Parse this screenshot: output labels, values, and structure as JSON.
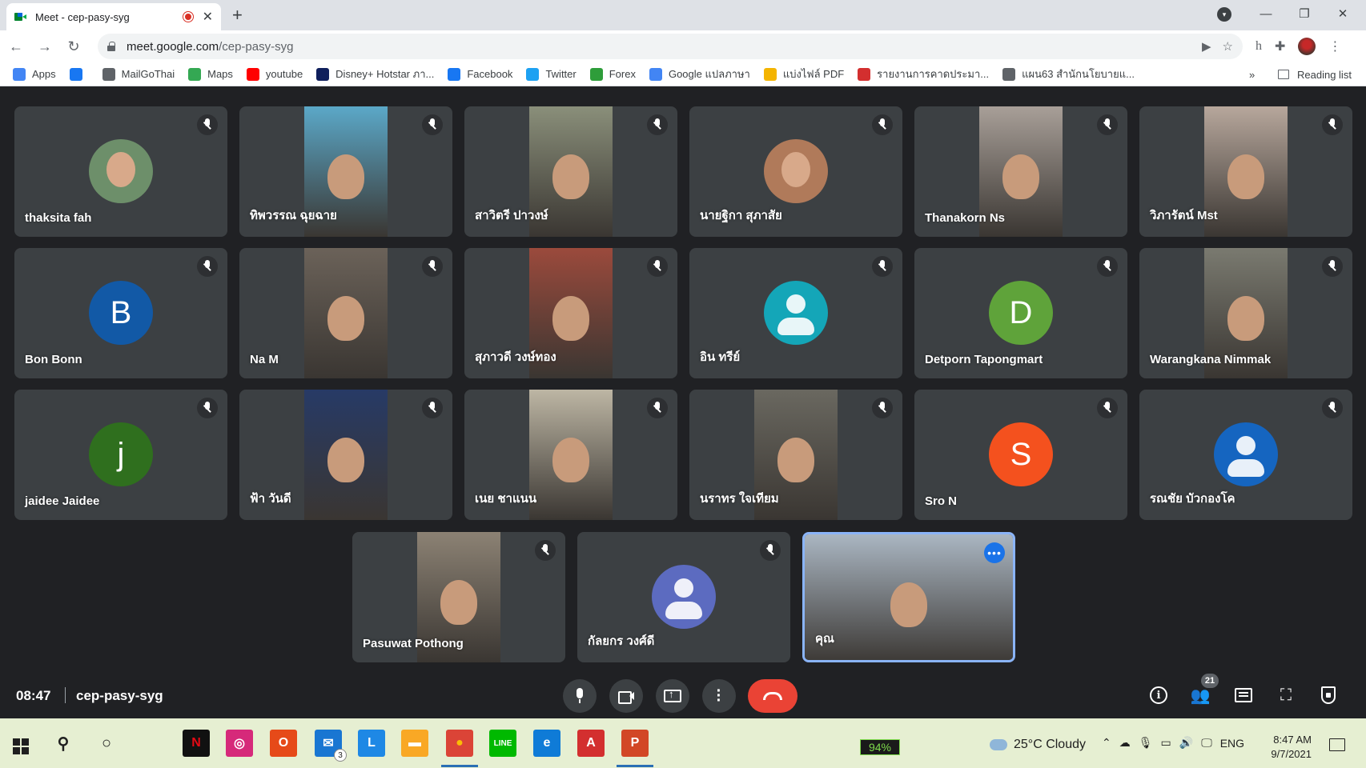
{
  "browser": {
    "tab_title": "Meet - cep-pasy-syg",
    "tab_close": "✕",
    "new_tab": "+",
    "url_host": "meet.google.com",
    "url_path": "/cep-pasy-syg",
    "window_controls": {
      "minimize": "—",
      "maximize": "❐",
      "close": "✕"
    },
    "bookmarks": [
      {
        "label": "Apps",
        "icon": "apps-grid-icon",
        "color": "#4285f4"
      },
      {
        "label": "",
        "icon": "facebook-icon",
        "color": "#1877f2"
      },
      {
        "label": "MailGoThai",
        "icon": "globe-icon",
        "color": "#5f6368"
      },
      {
        "label": "Maps",
        "icon": "maps-pin-icon",
        "color": "#34a853"
      },
      {
        "label": "youtube",
        "icon": "youtube-icon",
        "color": "#ff0000"
      },
      {
        "label": "Disney+ Hotstar ภา...",
        "icon": "hotstar-icon",
        "color": "#0f1f5c"
      },
      {
        "label": "Facebook",
        "icon": "facebook-icon",
        "color": "#1877f2"
      },
      {
        "label": "Twitter",
        "icon": "twitter-icon",
        "color": "#1da1f2"
      },
      {
        "label": "Forex",
        "icon": "forex-icon",
        "color": "#2e9d3a"
      },
      {
        "label": "Google แปลภาษา",
        "icon": "translate-icon",
        "color": "#4285f4"
      },
      {
        "label": "แบ่งไฟล์ PDF",
        "icon": "pdf-split-icon",
        "color": "#f4b400"
      },
      {
        "label": "รายงานการคาดประมา...",
        "icon": "report-icon",
        "color": "#d32f2f"
      },
      {
        "label": "แผน63 สำนักนโยบายแ...",
        "icon": "globe-icon",
        "color": "#5f6368"
      }
    ],
    "bookmarks_more": "»",
    "reading_list": "Reading list"
  },
  "participants": [
    {
      "name": "thaksita fah",
      "type": "photo-avatar",
      "color": "#6d8f6a"
    },
    {
      "name": "ทิพวรรณ ฉุยฉาย",
      "type": "video",
      "color": "#5ba8c8"
    },
    {
      "name": "สาวิตรี ปาวงษ์",
      "type": "video",
      "color": "#8a8f7a"
    },
    {
      "name": "นายฐิกา สุภาสัย",
      "type": "photo-avatar",
      "color": "#b07a5a"
    },
    {
      "name": "Thanakorn Ns",
      "type": "video",
      "color": "#a89f98"
    },
    {
      "name": "วิภารัตน์ Mst",
      "type": "video",
      "color": "#b7a79c"
    },
    {
      "name": "Bon Bonn",
      "type": "letter",
      "letter": "B",
      "color": "#1259a6"
    },
    {
      "name": "Na M",
      "type": "video",
      "color": "#6b6259"
    },
    {
      "name": "สุภาวดี วงษ์ทอง",
      "type": "video",
      "color": "#9b4a3c"
    },
    {
      "name": "อิน ทรีย์",
      "type": "person",
      "color": "#14a6b8"
    },
    {
      "name": "Detporn Tapongmart",
      "type": "letter",
      "letter": "D",
      "color": "#5fa33a"
    },
    {
      "name": "Warangkana Nimmak",
      "type": "video",
      "color": "#7a7a70"
    },
    {
      "name": "jaidee Jaidee",
      "type": "letter",
      "letter": "j",
      "color": "#2f6f1e"
    },
    {
      "name": "ฟ้า วันดี",
      "type": "video",
      "color": "#273a66"
    },
    {
      "name": "เนย ชาแนน",
      "type": "video",
      "color": "#bdb6a4"
    },
    {
      "name": "นราทร ใจเทียม",
      "type": "video",
      "color": "#6a6860"
    },
    {
      "name": "Sro N",
      "type": "letter",
      "letter": "S",
      "color": "#f4511e"
    },
    {
      "name": "รณชัย บัวกองโค",
      "type": "person",
      "color": "#1565c0"
    },
    {
      "name": "Pasuwat Pothong",
      "type": "video",
      "color": "#8c8274"
    },
    {
      "name": "กัลยกร วงศ์ดี",
      "type": "person",
      "color": "#5c6bc0"
    },
    {
      "name": "คุณ",
      "type": "video",
      "color": "#aab6c2"
    }
  ],
  "meeting": {
    "time": "08:47",
    "code": "cep-pasy-syg",
    "participant_count": "21",
    "more_dots": "•••"
  },
  "taskbar": {
    "apps": [
      {
        "name": "netflix",
        "label": "N",
        "color": "#111111",
        "fg": "#e50914"
      },
      {
        "name": "instagram",
        "label": "◎",
        "color": "#d6297a",
        "fg": "#ffffff"
      },
      {
        "name": "office",
        "label": "O",
        "color": "#e64a19",
        "fg": "#ffffff"
      },
      {
        "name": "mail",
        "label": "✉",
        "color": "#1976d2",
        "fg": "#ffffff"
      },
      {
        "name": "l-app",
        "label": "L",
        "color": "#1e88e5",
        "fg": "#ffffff"
      },
      {
        "name": "file-explorer",
        "label": "▬",
        "color": "#f9a825",
        "fg": "#ffffff"
      },
      {
        "name": "chrome",
        "label": "●",
        "color": "#db4437",
        "fg": "#fbbc05"
      },
      {
        "name": "line",
        "label": "LINE",
        "color": "#00b900",
        "fg": "#ffffff"
      },
      {
        "name": "edge",
        "label": "e",
        "color": "#0f7bd7",
        "fg": "#ffffff"
      },
      {
        "name": "acrobat",
        "label": "A",
        "color": "#d32f2f",
        "fg": "#ffffff"
      },
      {
        "name": "powerpoint",
        "label": "P",
        "color": "#d24726",
        "fg": "#ffffff"
      }
    ],
    "mail_badge": "3",
    "battery": "94%",
    "weather": "25°C  Cloudy",
    "language": "ENG",
    "clock_time": "8:47 AM",
    "clock_date": "9/7/2021"
  }
}
